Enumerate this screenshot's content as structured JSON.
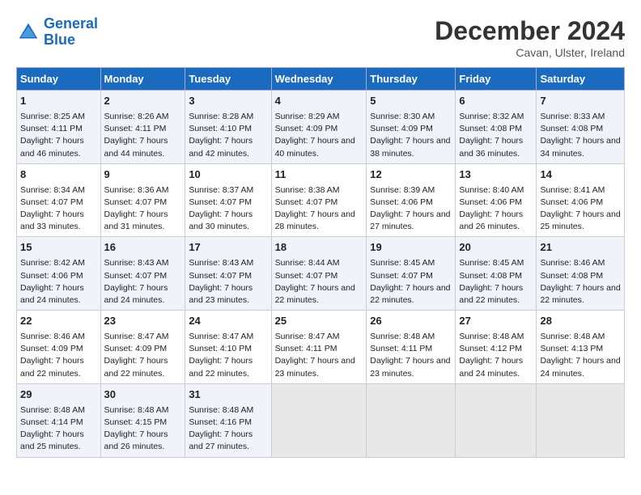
{
  "header": {
    "logo_line1": "General",
    "logo_line2": "Blue",
    "title": "December 2024",
    "subtitle": "Cavan, Ulster, Ireland"
  },
  "days_of_week": [
    "Sunday",
    "Monday",
    "Tuesday",
    "Wednesday",
    "Thursday",
    "Friday",
    "Saturday"
  ],
  "weeks": [
    [
      {
        "day": "1",
        "sunrise": "Sunrise: 8:25 AM",
        "sunset": "Sunset: 4:11 PM",
        "daylight": "Daylight: 7 hours and 46 minutes."
      },
      {
        "day": "2",
        "sunrise": "Sunrise: 8:26 AM",
        "sunset": "Sunset: 4:11 PM",
        "daylight": "Daylight: 7 hours and 44 minutes."
      },
      {
        "day": "3",
        "sunrise": "Sunrise: 8:28 AM",
        "sunset": "Sunset: 4:10 PM",
        "daylight": "Daylight: 7 hours and 42 minutes."
      },
      {
        "day": "4",
        "sunrise": "Sunrise: 8:29 AM",
        "sunset": "Sunset: 4:09 PM",
        "daylight": "Daylight: 7 hours and 40 minutes."
      },
      {
        "day": "5",
        "sunrise": "Sunrise: 8:30 AM",
        "sunset": "Sunset: 4:09 PM",
        "daylight": "Daylight: 7 hours and 38 minutes."
      },
      {
        "day": "6",
        "sunrise": "Sunrise: 8:32 AM",
        "sunset": "Sunset: 4:08 PM",
        "daylight": "Daylight: 7 hours and 36 minutes."
      },
      {
        "day": "7",
        "sunrise": "Sunrise: 8:33 AM",
        "sunset": "Sunset: 4:08 PM",
        "daylight": "Daylight: 7 hours and 34 minutes."
      }
    ],
    [
      {
        "day": "8",
        "sunrise": "Sunrise: 8:34 AM",
        "sunset": "Sunset: 4:07 PM",
        "daylight": "Daylight: 7 hours and 33 minutes."
      },
      {
        "day": "9",
        "sunrise": "Sunrise: 8:36 AM",
        "sunset": "Sunset: 4:07 PM",
        "daylight": "Daylight: 7 hours and 31 minutes."
      },
      {
        "day": "10",
        "sunrise": "Sunrise: 8:37 AM",
        "sunset": "Sunset: 4:07 PM",
        "daylight": "Daylight: 7 hours and 30 minutes."
      },
      {
        "day": "11",
        "sunrise": "Sunrise: 8:38 AM",
        "sunset": "Sunset: 4:07 PM",
        "daylight": "Daylight: 7 hours and 28 minutes."
      },
      {
        "day": "12",
        "sunrise": "Sunrise: 8:39 AM",
        "sunset": "Sunset: 4:06 PM",
        "daylight": "Daylight: 7 hours and 27 minutes."
      },
      {
        "day": "13",
        "sunrise": "Sunrise: 8:40 AM",
        "sunset": "Sunset: 4:06 PM",
        "daylight": "Daylight: 7 hours and 26 minutes."
      },
      {
        "day": "14",
        "sunrise": "Sunrise: 8:41 AM",
        "sunset": "Sunset: 4:06 PM",
        "daylight": "Daylight: 7 hours and 25 minutes."
      }
    ],
    [
      {
        "day": "15",
        "sunrise": "Sunrise: 8:42 AM",
        "sunset": "Sunset: 4:06 PM",
        "daylight": "Daylight: 7 hours and 24 minutes."
      },
      {
        "day": "16",
        "sunrise": "Sunrise: 8:43 AM",
        "sunset": "Sunset: 4:07 PM",
        "daylight": "Daylight: 7 hours and 24 minutes."
      },
      {
        "day": "17",
        "sunrise": "Sunrise: 8:43 AM",
        "sunset": "Sunset: 4:07 PM",
        "daylight": "Daylight: 7 hours and 23 minutes."
      },
      {
        "day": "18",
        "sunrise": "Sunrise: 8:44 AM",
        "sunset": "Sunset: 4:07 PM",
        "daylight": "Daylight: 7 hours and 22 minutes."
      },
      {
        "day": "19",
        "sunrise": "Sunrise: 8:45 AM",
        "sunset": "Sunset: 4:07 PM",
        "daylight": "Daylight: 7 hours and 22 minutes."
      },
      {
        "day": "20",
        "sunrise": "Sunrise: 8:45 AM",
        "sunset": "Sunset: 4:08 PM",
        "daylight": "Daylight: 7 hours and 22 minutes."
      },
      {
        "day": "21",
        "sunrise": "Sunrise: 8:46 AM",
        "sunset": "Sunset: 4:08 PM",
        "daylight": "Daylight: 7 hours and 22 minutes."
      }
    ],
    [
      {
        "day": "22",
        "sunrise": "Sunrise: 8:46 AM",
        "sunset": "Sunset: 4:09 PM",
        "daylight": "Daylight: 7 hours and 22 minutes."
      },
      {
        "day": "23",
        "sunrise": "Sunrise: 8:47 AM",
        "sunset": "Sunset: 4:09 PM",
        "daylight": "Daylight: 7 hours and 22 minutes."
      },
      {
        "day": "24",
        "sunrise": "Sunrise: 8:47 AM",
        "sunset": "Sunset: 4:10 PM",
        "daylight": "Daylight: 7 hours and 22 minutes."
      },
      {
        "day": "25",
        "sunrise": "Sunrise: 8:47 AM",
        "sunset": "Sunset: 4:11 PM",
        "daylight": "Daylight: 7 hours and 23 minutes."
      },
      {
        "day": "26",
        "sunrise": "Sunrise: 8:48 AM",
        "sunset": "Sunset: 4:11 PM",
        "daylight": "Daylight: 7 hours and 23 minutes."
      },
      {
        "day": "27",
        "sunrise": "Sunrise: 8:48 AM",
        "sunset": "Sunset: 4:12 PM",
        "daylight": "Daylight: 7 hours and 24 minutes."
      },
      {
        "day": "28",
        "sunrise": "Sunrise: 8:48 AM",
        "sunset": "Sunset: 4:13 PM",
        "daylight": "Daylight: 7 hours and 24 minutes."
      }
    ],
    [
      {
        "day": "29",
        "sunrise": "Sunrise: 8:48 AM",
        "sunset": "Sunset: 4:14 PM",
        "daylight": "Daylight: 7 hours and 25 minutes."
      },
      {
        "day": "30",
        "sunrise": "Sunrise: 8:48 AM",
        "sunset": "Sunset: 4:15 PM",
        "daylight": "Daylight: 7 hours and 26 minutes."
      },
      {
        "day": "31",
        "sunrise": "Sunrise: 8:48 AM",
        "sunset": "Sunset: 4:16 PM",
        "daylight": "Daylight: 7 hours and 27 minutes."
      },
      null,
      null,
      null,
      null
    ]
  ]
}
